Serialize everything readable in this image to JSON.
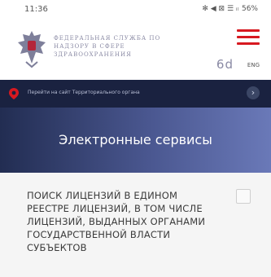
{
  "status": {
    "time": "11:36",
    "icons": "✻ ◀ ⊠ ☰ ᵢₗ",
    "battery": "56%"
  },
  "header": {
    "org_name": "Федеральная служба по надзору в сфере здравоохранения",
    "a11y_label": "6d",
    "lang": "ENG"
  },
  "banner": {
    "text": "Перейти на сайт Территориального органа",
    "arrow": "›"
  },
  "hero": {
    "title": "Электронные сервисы"
  },
  "card": {
    "title": "ПОИСК ЛИЦЕНЗИЙ В ЕДИНОМ РЕЕСТРЕ ЛИЦЕНЗИЙ, В ТОМ ЧИСЛЕ ЛИЦЕНЗИЙ, ВЫДАННЫХ ОРГАНАМИ ГОСУДАРСТВЕННОЙ ВЛАСТИ СУБЪЕКТОВ"
  },
  "colors": {
    "accent": "#d71920",
    "banner_bg": "#1a2240"
  }
}
